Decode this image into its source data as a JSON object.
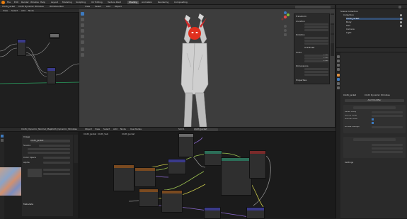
{
  "menu": {
    "items": [
      "File",
      "Edit",
      "Render",
      "Window",
      "Help"
    ],
    "workspaces": [
      "Layout",
      "Modeling",
      "Sculpting",
      "UV Editing",
      "Texture Paint",
      "Shading",
      "Animation",
      "Rendering",
      "Compositing"
    ],
    "active_workspace": "Shading"
  },
  "node_editor_top_left": {
    "tabs": [
      "Cloth_Jacket",
      "Cloth Dynamic Wrinkles",
      "Wrinkles Max"
    ],
    "menu": [
      "View",
      "Select",
      "Add",
      "Node"
    ]
  },
  "viewport": {
    "menu": [
      "View",
      "Select",
      "Add",
      "Object"
    ]
  },
  "n_panel": {
    "sections": [
      "Transform",
      "Location",
      "Rotation",
      "Scale",
      "Dimensions",
      "Properties"
    ],
    "mode": "XYZ Euler",
    "scale_values": [
      "1.000",
      "1.000",
      "1.000"
    ],
    "tabs": [
      "Item",
      "Tool",
      "View"
    ]
  },
  "outliner": {
    "title": "Scene Collection",
    "items": [
      "Collection",
      "Cloth_Jacket",
      "Body",
      "Hair",
      "Camera",
      "Light"
    ]
  },
  "properties": {
    "object_name": "Cloth_Jacket",
    "modifier_tab": "Cloth Dynamic Wrinkles",
    "add_modifier": "Add Modifier",
    "rows": [
      "Vertex Group",
      "Normal Offset",
      "Modifier Mode",
      "Wrinkle Strength"
    ],
    "section": "Settings"
  },
  "image_editor": {
    "tabs": [
      "Cloth_Dynamic_Normal_Map",
      "Cloth_Dynamic_Wrinkles"
    ],
    "sidebar_sections": [
      "Image",
      "Source",
      "Color Space",
      "Alpha",
      "Metadata"
    ],
    "image_name": "Cloth_Jacket"
  },
  "shader_editor": {
    "tabs": [
      "Object",
      "View",
      "Select",
      "Add",
      "Node"
    ],
    "use_nodes": "Use Nodes",
    "slot": "Slot 1",
    "material": "Cloth_Jacket",
    "breadcrumb": "Cloth_Jacket",
    "breadcrumb2": "Cloth_Sub",
    "breadcrumb3": "Cloth_Jacket"
  },
  "colors": {
    "accent": "#3d7abf",
    "header": "#2b2b2b",
    "node_tex": "#7a4a20",
    "node_shader": "#2c6e58",
    "node_vector": "#3a3a8a",
    "link_green": "#9ec552",
    "link_yellow": "#c8c84a",
    "link_purple": "#8c6ad0",
    "link_gray": "#8f8f8f"
  }
}
